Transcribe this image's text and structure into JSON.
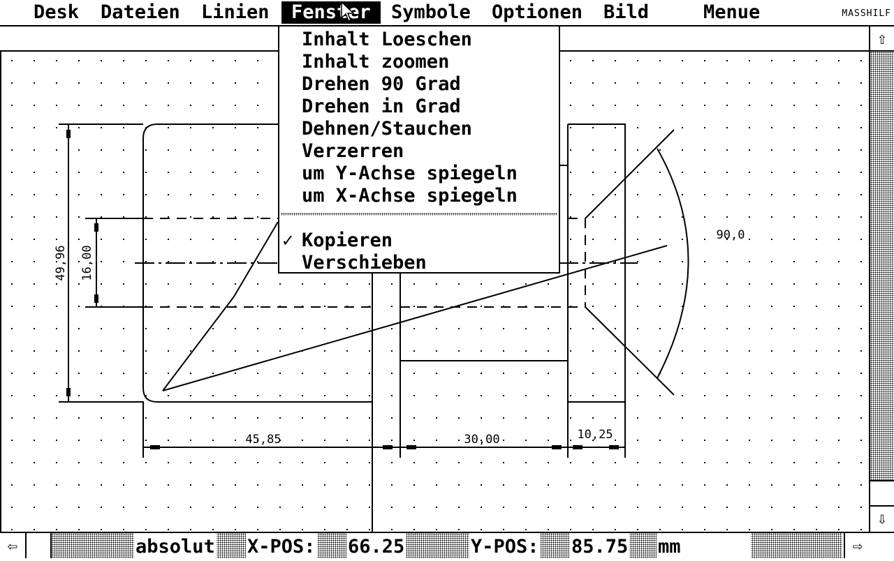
{
  "menubar": {
    "items": [
      "Desk",
      "Dateien",
      "Linien",
      "Fenster",
      "Symbole",
      "Optionen",
      "Bild",
      "Menue"
    ],
    "active": "Fenster",
    "app_name": "MASSHILF"
  },
  "dropdown": {
    "items": [
      "Inhalt Loeschen",
      "Inhalt zoomen",
      "Drehen 90 Grad",
      "Drehen in Grad",
      "Dehnen/Stauchen",
      "Verzerren",
      "um Y-Achse spiegeln",
      "um X-Achse spiegeln"
    ],
    "items_lower": [
      "Kopieren",
      "Verschieben"
    ],
    "checked": "Kopieren",
    "check_mark": "✓"
  },
  "drawing": {
    "dimensions": {
      "total_height": "49,96",
      "inner_height": "16,00",
      "width_left": "45,85",
      "width_mid": "30,00",
      "width_right": "10,25",
      "angle": "90,0"
    }
  },
  "status": {
    "mode": "absolut",
    "x_label": "X-POS:",
    "x_value": "66.25",
    "y_label": "Y-POS:",
    "y_value": "85.75",
    "unit": "mm"
  },
  "scroll": {
    "up": "⇧",
    "down": "⇩",
    "left": "⇦",
    "right": "⇨"
  }
}
